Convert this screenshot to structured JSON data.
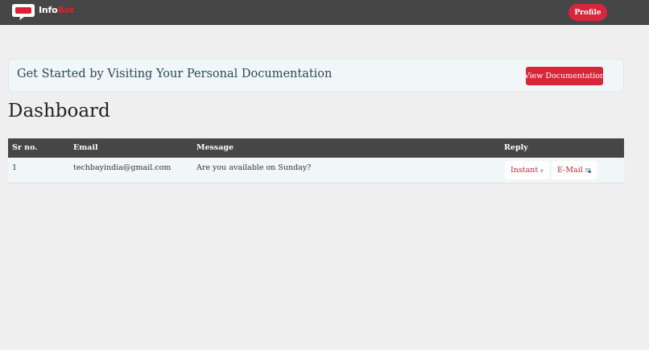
{
  "nav": {
    "brand_a": "Info",
    "brand_b": "Bot",
    "profile_label": "Profile"
  },
  "banner": {
    "text": "Get Started by Visiting Your Personal Documentation",
    "button_label": "View Documentation"
  },
  "page_title": "Dashboard",
  "table": {
    "headers": [
      "Sr no.",
      "Email",
      "Message",
      "Reply"
    ],
    "rows": [
      {
        "sr": "1",
        "email": "techbayindia@gmail.com",
        "message": "Are you available on Sunday?",
        "instant_label": "Instant",
        "email_label": "E-Mail"
      }
    ]
  },
  "icons": {
    "logo": "chat-bubble-icon",
    "instant": "lightning-icon",
    "email": "envelope-icon"
  },
  "colors": {
    "accent": "#d8263a",
    "navbar": "#464646",
    "banner_bg": "#f1f6f9"
  }
}
